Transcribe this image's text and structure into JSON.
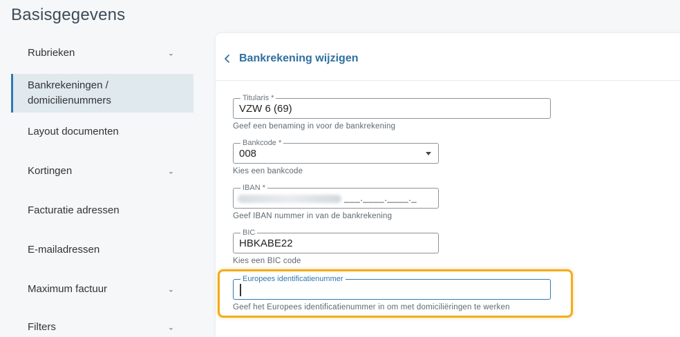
{
  "page_title": "Basisgegevens",
  "sidebar": {
    "items": [
      {
        "label": "Rubrieken",
        "has_chevron": true
      },
      {
        "label": "Bankrekeningen /\ndomicilienummers",
        "active": true
      },
      {
        "label": "Layout documenten"
      },
      {
        "label": "Kortingen",
        "has_chevron": true
      },
      {
        "label": "Facturatie adressen"
      },
      {
        "label": "E-mailadressen"
      },
      {
        "label": "Maximum factuur",
        "has_chevron": true
      },
      {
        "label": "Filters",
        "has_chevron": true
      }
    ]
  },
  "panel": {
    "title": "Bankrekening wijzigen",
    "fields": {
      "titularis": {
        "label": "Titularis *",
        "value": "VZW 6 (69)",
        "hint": "Geef een benaming in voor de bankrekening"
      },
      "bankcode": {
        "label": "Bankcode *",
        "value": "008",
        "hint": "Kies een bankcode"
      },
      "iban": {
        "label": "IBAN *",
        "value_tail": "___.____.____._",
        "hint": "Geef IBAN nummer in van de bankrekening"
      },
      "bic": {
        "label": "BIC",
        "value": "HBKABE22",
        "hint": "Kies een BIC code"
      },
      "europees": {
        "label": "Europees identificatienummer",
        "value": "",
        "hint": "Geef het Europees identificatienummer in om met domiciliëringen te werken"
      }
    }
  },
  "colors": {
    "accent": "#2f78b0",
    "highlight": "#f2ac1c",
    "active_bg": "#dfe9ee"
  },
  "icons": {
    "back": "chevron-left-icon",
    "expand": "chevron-down-icon",
    "select": "caret-down-icon"
  }
}
